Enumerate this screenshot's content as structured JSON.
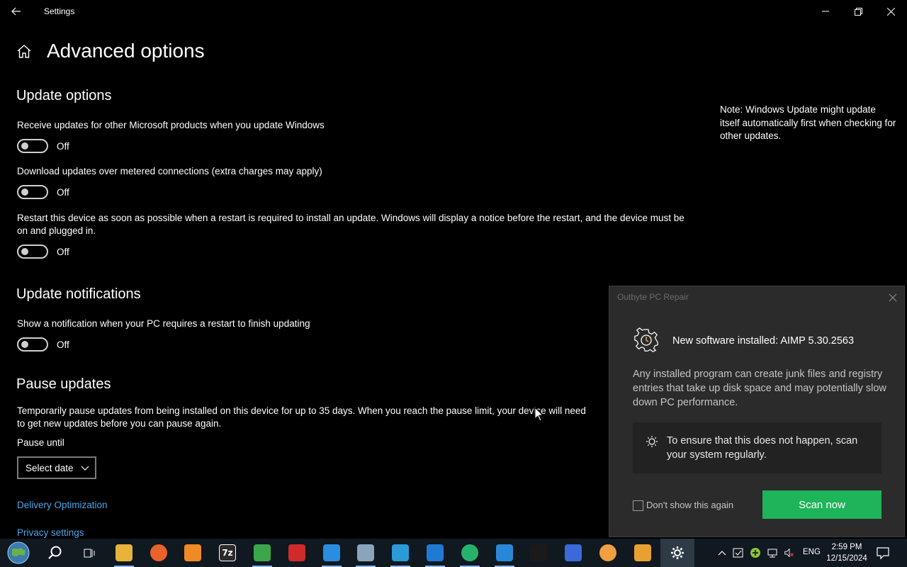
{
  "window": {
    "title": "Settings"
  },
  "page": {
    "title": "Advanced options"
  },
  "update_options": {
    "heading": "Update options",
    "items": [
      {
        "label": "Receive updates for other Microsoft products when you update Windows",
        "state": "Off"
      },
      {
        "label": "Download updates over metered connections (extra charges may apply)",
        "state": "Off"
      },
      {
        "label": "Restart this device as soon as possible when a restart is required to install an update. Windows will display a notice before the restart, and the device must be on and plugged in.",
        "state": "Off"
      }
    ]
  },
  "note": "Note: Windows Update might update itself automatically first when checking for other updates.",
  "update_notifications": {
    "heading": "Update notifications",
    "label": "Show a notification when your PC requires a restart to finish updating",
    "state": "Off"
  },
  "pause_updates": {
    "heading": "Pause updates",
    "description": "Temporarily pause updates from being installed on this device for up to 35 days. When you reach the pause limit, your device will need to get new updates before you can pause again.",
    "pause_until_label": "Pause until",
    "select_value": "Select date"
  },
  "links": {
    "delivery": "Delivery Optimization",
    "privacy": "Privacy settings"
  },
  "popup": {
    "app_name": "Outbyte PC Repair",
    "title": "New software installed: AIMP 5.30.2563",
    "body": "Any installed program can create junk files and registry entries that take up disk space and may potentially slow down PC performance.",
    "tip": "To ensure that this does not happen, scan your system regularly.",
    "checkbox_label": "Don't show this again",
    "scan_button": "Scan now"
  },
  "taskbar": {
    "apps": [
      {
        "name": "task-view-icon",
        "label": ""
      },
      {
        "name": "file-explorer-icon",
        "label": "",
        "color": "#e8b33a"
      },
      {
        "name": "firefox-icon",
        "label": "",
        "color": "#e8622a"
      },
      {
        "name": "search-app-icon",
        "label": "",
        "color": "#f08a24"
      },
      {
        "name": "7zip-icon",
        "label": "7z",
        "color": "#2b2b2b"
      },
      {
        "name": "green-app-icon",
        "label": "",
        "color": "#3aa84a"
      },
      {
        "name": "red-app-icon",
        "label": "",
        "color": "#d02a2a"
      },
      {
        "name": "blue-tool-icon",
        "label": "",
        "color": "#2a8ee0"
      },
      {
        "name": "gear-app-icon",
        "label": "",
        "color": "#8aa4bc"
      },
      {
        "name": "cube-app-icon",
        "label": "",
        "color": "#2a9ad8"
      },
      {
        "name": "blue-square-icon",
        "label": "",
        "color": "#1f7ad4"
      },
      {
        "name": "green-circle-icon",
        "label": "",
        "color": "#27b26b"
      },
      {
        "name": "globe-app-icon",
        "label": "",
        "color": "#2a86d8"
      },
      {
        "name": "terminal-icon",
        "label": "",
        "color": "#1a1a1a"
      },
      {
        "name": "feather-icon",
        "label": "",
        "color": "#3a6ad8"
      },
      {
        "name": "aimp-icon",
        "label": "",
        "color": "#f0a040"
      },
      {
        "name": "photo-viewer-icon",
        "label": "",
        "color": "#e8a030"
      },
      {
        "name": "settings-icon",
        "label": "",
        "color": "#cfcfcf"
      }
    ],
    "language": "ENG",
    "time": "2:59 PM",
    "date": "12/15/2024"
  }
}
